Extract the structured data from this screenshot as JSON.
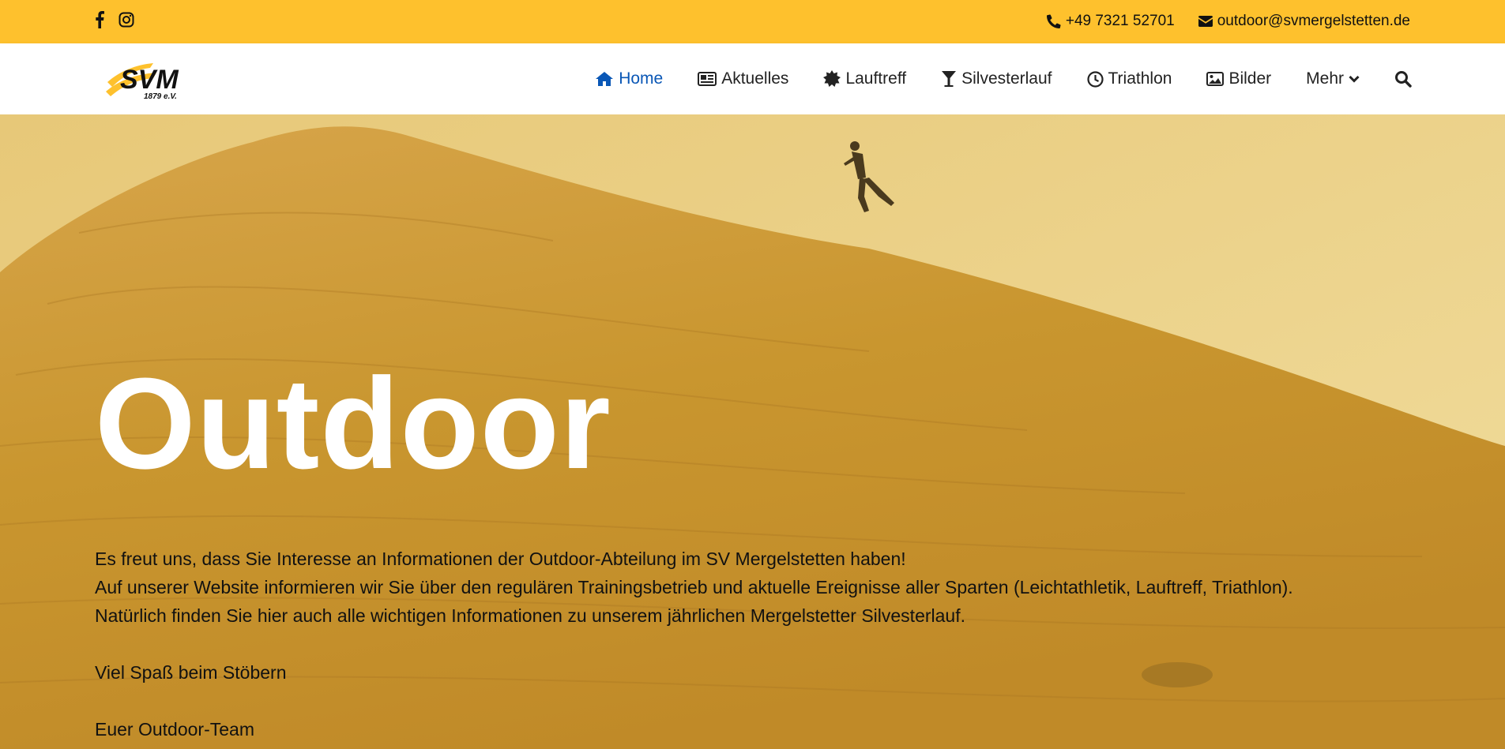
{
  "topbar": {
    "social": [
      {
        "icon": "facebook-icon"
      },
      {
        "icon": "instagram-icon"
      }
    ],
    "phone": "+49 7321 52701",
    "email": "outdoor@svmergelstetten.de"
  },
  "logo": {
    "text": "SVM",
    "subtext": "1879 e.V."
  },
  "nav": {
    "items": [
      {
        "label": "Home",
        "icon": "home-icon",
        "active": true
      },
      {
        "label": "Aktuelles",
        "icon": "newspaper-icon"
      },
      {
        "label": "Lauftreff",
        "icon": "sun-badge-icon"
      },
      {
        "label": "Silvesterlauf",
        "icon": "cocktail-glass-icon"
      },
      {
        "label": "Triathlon",
        "icon": "clock-icon"
      },
      {
        "label": "Bilder",
        "icon": "image-icon"
      },
      {
        "label": "Mehr",
        "icon": "chevron-down-icon"
      }
    ],
    "search_icon": "search-icon"
  },
  "hero": {
    "title": "Outdoor",
    "paragraph_lines": [
      "Es freut uns, dass Sie Interesse an Informationen der Outdoor-Abteilung im SV Mergelstetten haben!",
      "Auf unserer Website informieren wir Sie über den regulären Trainingsbetrieb und aktuelle Ereignisse aller Sparten (Leichtathletik, Lauftreff, Triathlon).",
      "Natürlich finden Sie hier auch alle wichtigen Informationen zu unserem jährlichen Mergelstetter Silvesterlauf."
    ],
    "greeting": "Viel Spaß beim Stöbern",
    "signature": "Euer Outdoor-Team"
  },
  "colors": {
    "topbar_bg": "#fec12d",
    "nav_bg": "#ffffff",
    "nav_active": "#0a57b6",
    "hero_sand": "#c9962f",
    "hero_sky": "#ead28c"
  }
}
